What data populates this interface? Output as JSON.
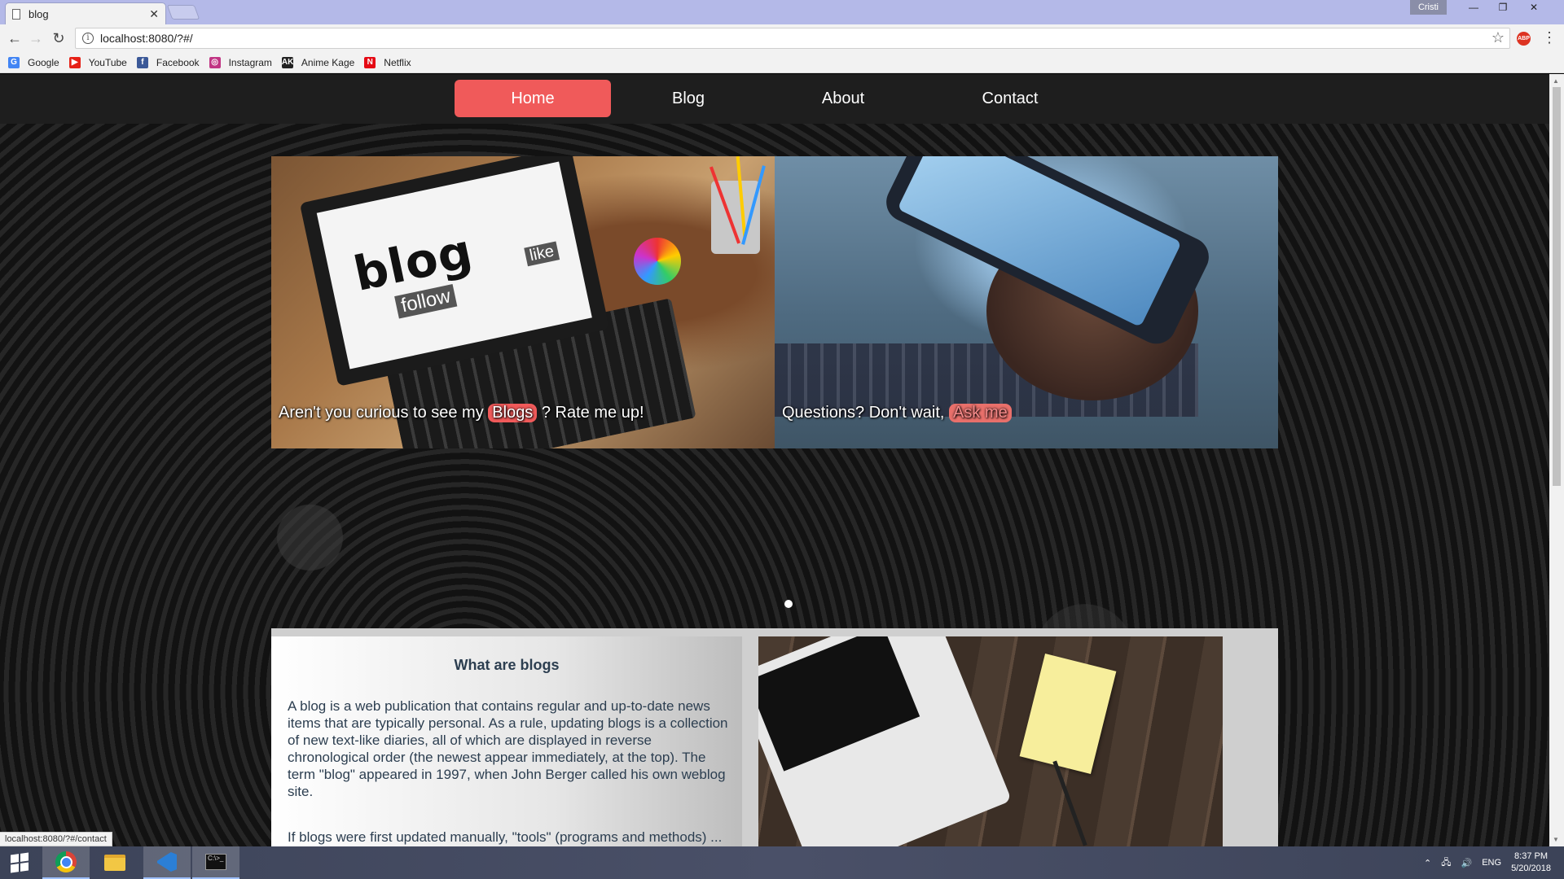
{
  "browser": {
    "tab_title": "blog",
    "tab_close": "✕",
    "profile_name": "Cristi",
    "win_minimize": "—",
    "win_restore": "❐",
    "win_close": "✕",
    "url": "localhost:8080/?#/",
    "status_url": "localhost:8080/?#/contact",
    "abp_label": "ABP"
  },
  "bookmarks": [
    {
      "label": "Google",
      "icon": "google-icon",
      "color": "#4285f4",
      "glyph": "G"
    },
    {
      "label": "YouTube",
      "icon": "youtube-icon",
      "color": "#e62117",
      "glyph": "▶"
    },
    {
      "label": "Facebook",
      "icon": "facebook-icon",
      "color": "#3b5998",
      "glyph": "f"
    },
    {
      "label": "Instagram",
      "icon": "instagram-icon",
      "color": "#c13584",
      "glyph": "◎"
    },
    {
      "label": "Anime Kage",
      "icon": "animekage-icon",
      "color": "#222222",
      "glyph": "AK"
    },
    {
      "label": "Netflix",
      "icon": "netflix-icon",
      "color": "#e50914",
      "glyph": "N"
    }
  ],
  "site_nav": {
    "items": [
      "Home",
      "Blog",
      "About",
      "Contact"
    ],
    "active": "Home",
    "accent": "#f05a5a"
  },
  "carousel": {
    "slide1": {
      "text_before": "Aren't you curious to see my",
      "pill": "Blogs",
      "text_after": "? Rate me up!",
      "image_words": {
        "blog": "blog",
        "follow": "follow",
        "like": "like"
      }
    },
    "slide2": {
      "text_before": "Questions? Don't wait,",
      "pill": "Ask me"
    }
  },
  "info": {
    "title": "What are blogs",
    "paragraph1": "A blog is a web publication that contains regular and up-to-date news items that are typically personal. As a rule, updating blogs is a collection of new text-like diaries, all of which are displayed in reverse chronological order (the newest appear immediately, at the top). The term \"blog\" appeared in 1997, when John Berger called his own weblog site.",
    "paragraph2": "If blogs were first updated manually, \"tools\" (programs and methods) ... Using such software based on"
  },
  "taskbar": {
    "tray_lang": "ENG",
    "time": "8:37 PM",
    "date": "5/20/2018",
    "cmd_label": "C:\\>_"
  }
}
